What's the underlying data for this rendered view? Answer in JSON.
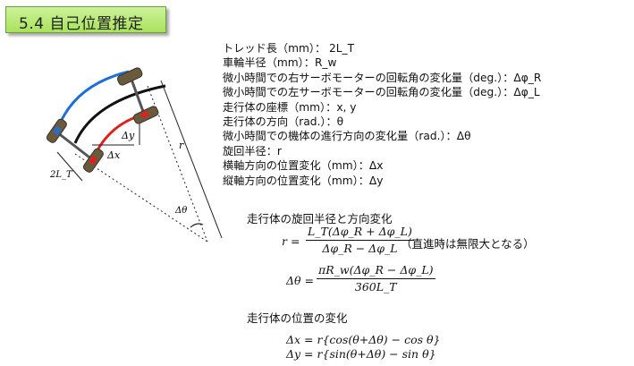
{
  "slide_title": "5.4 自己位置推定",
  "definitions": [
    "トレッド長（mm）： 2L_T",
    "車輪半径（mm）：R_w",
    "微小時間での右サーボモーターの回転角の変化量（deg.）：Δφ_R",
    "微小時間での左サーボモーターの回転角の変化量（deg.）：Δφ_L",
    "走行体の座標（mm）：x, y",
    "走行体の方向（rad.）：θ",
    "微小時間での機体の進行方向の変化量（rad.）：Δθ",
    "旋回半径：r",
    "横軸方向の位置変化（mm）：Δx",
    "縦軸方向の位置変化（mm）：Δy"
  ],
  "section1_heading": "走行体の旋回半径と方向変化",
  "eq_r": {
    "lhs": "r =",
    "numerator": "L_T(Δφ_R + Δφ_L)",
    "denominator": "Δφ_R − Δφ_L",
    "note": "（直進時は無限大となる）"
  },
  "eq_dtheta": {
    "lhs": "Δθ =",
    "numerator": "πR_w(Δφ_R − Δφ_L)",
    "denominator": "360L_T"
  },
  "section2_heading": "走行体の位置の変化",
  "eq_dx": "Δx = r{cos(θ+Δθ) − cos θ}",
  "eq_dy": "Δy = r{sin(θ+Δθ) − sin θ}",
  "diagram_labels": {
    "tread": "2L_T",
    "dx": "Δx",
    "dy": "Δy",
    "r": "r",
    "dtheta": "Δθ"
  },
  "colors": {
    "title_bg": "#b6e872",
    "right_wheel_arc": "#1f6fd6",
    "left_wheel_arc": "#e0201e",
    "wheel": "#6b5a3a"
  }
}
